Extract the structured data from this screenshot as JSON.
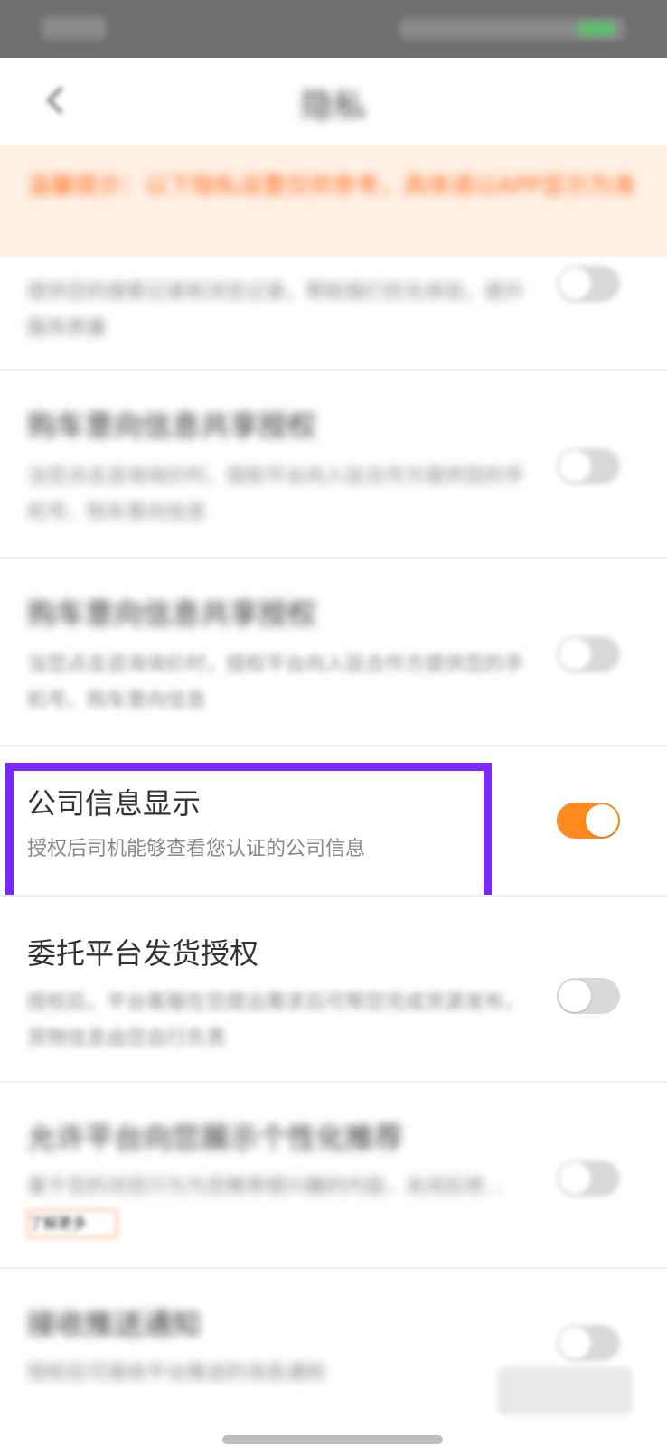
{
  "status_bar": {
    "time": "",
    "battery_color": "#5fbf6f"
  },
  "header": {
    "title": "隐私",
    "back_icon": "chevron-left-icon"
  },
  "banner": {
    "text": "温馨提示：以下隐私设置仅供参考，具体请以APP显示为准"
  },
  "settings": [
    {
      "title": "",
      "desc": "提供您的搜索记录和浏览记录，帮助我们优化体验，提升服务质量",
      "enabled": false
    },
    {
      "title": "购车意向信息共享授权",
      "desc": "当您点击咨询询价时，授权平台向入驻合作方提供您的手机号、购车意向信息",
      "enabled": false
    },
    {
      "title": "购车意向信息共享授权",
      "desc": "当您点击咨询询价时，授权平台向入驻合作方提供您的手机号、购车意向信息",
      "enabled": false
    },
    {
      "title": "公司信息显示",
      "desc": "授权后司机能够查看您认证的公司信息",
      "enabled": true
    },
    {
      "title": "委托平台发货授权",
      "desc": "授权后，平台客服在您提出需求后可帮您完成货源发布，货物信息由您自行负责",
      "enabled": false
    },
    {
      "title": "允许平台向您展示个性化推荐",
      "desc": "基于您的浏览行为为您推荐感兴趣的内容，关闭后将...",
      "tag": "了解更多",
      "enabled": false
    },
    {
      "title": "接收推送通知",
      "desc": "授权后可接收平台推送的消息通知",
      "enabled": false
    }
  ],
  "colors": {
    "accent": "#ff8a1f",
    "highlight": "#7a28ff",
    "banner_text": "#ff6a1a"
  }
}
